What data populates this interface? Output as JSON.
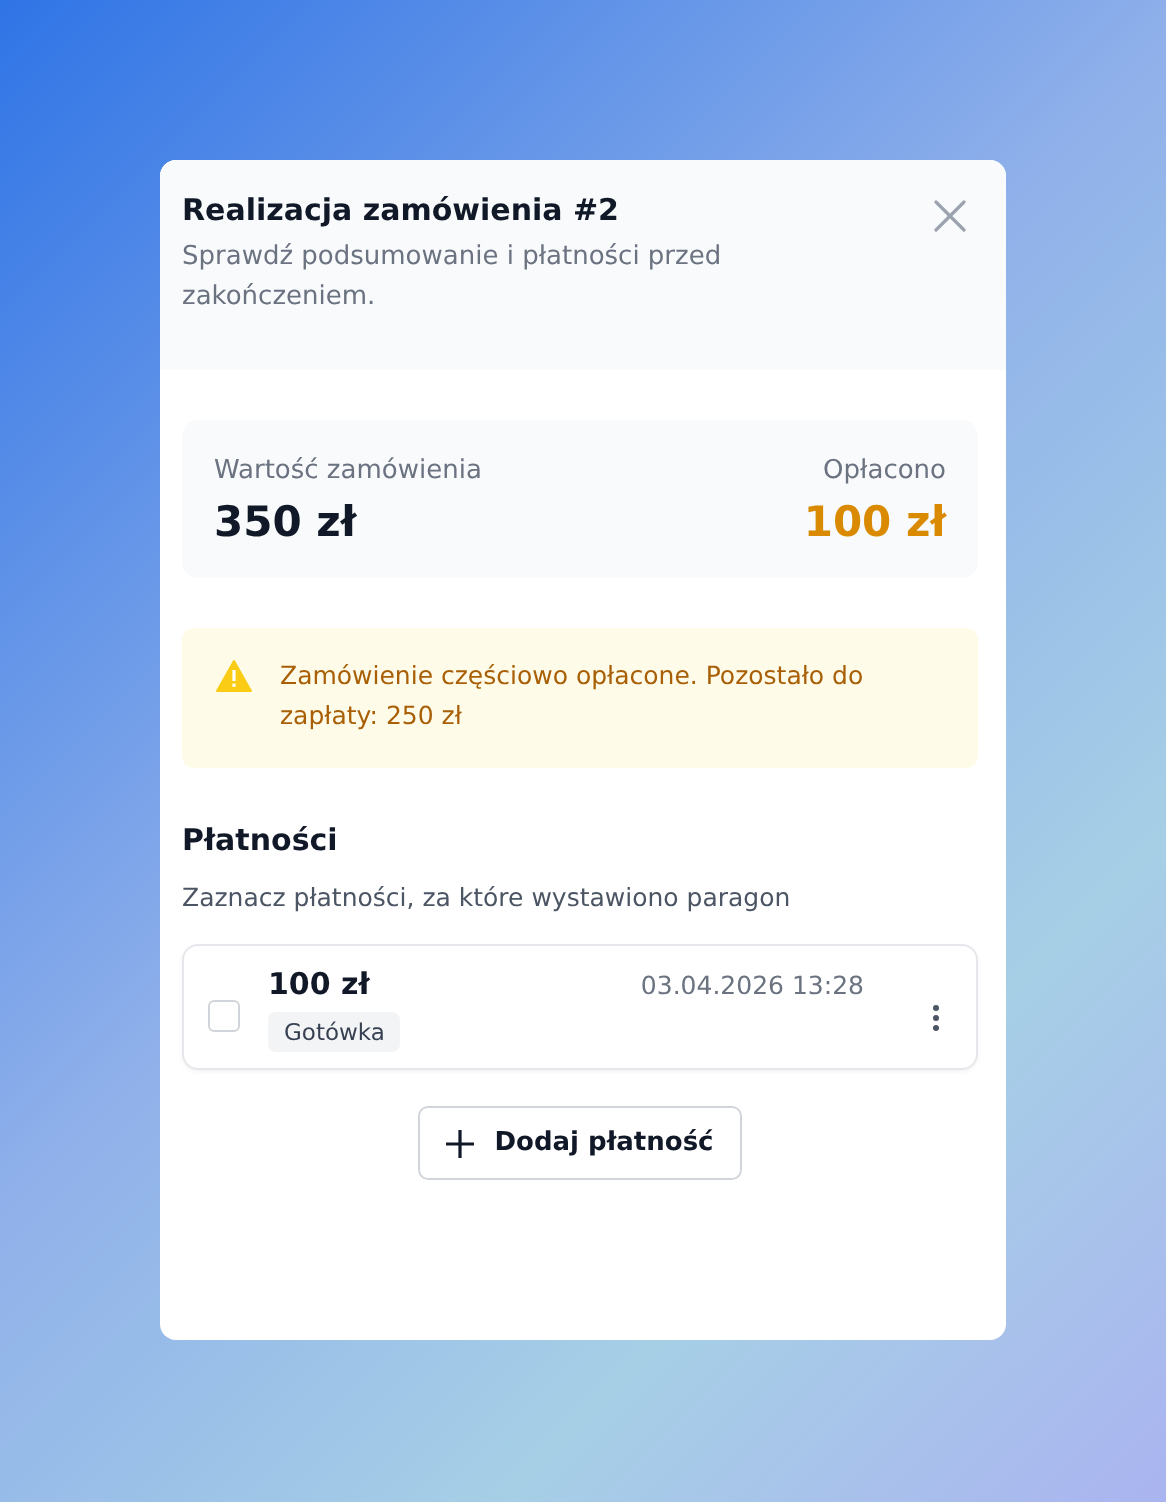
{
  "dialog": {
    "title": "Realizacja zamówienia #2",
    "subtitle": "Sprawdź podsumowanie i płatności przed zakończeniem."
  },
  "summary": {
    "order_label": "Wartość zamówienia",
    "order_value": "350 zł",
    "paid_label": "Opłacono",
    "paid_value": "100 zł"
  },
  "alert": {
    "kind": "warning",
    "text": "Zamówienie częściowo opłacone. Pozostało do zapłaty: 250 zł"
  },
  "payments": {
    "title": "Płatności",
    "hint": "Zaznacz płatności, za które wystawiono paragon",
    "items": [
      {
        "amount": "100 zł",
        "method": "Gotówka",
        "date": "03.04.2026 13:28",
        "checked": false
      }
    ],
    "add_button": "Dodaj płatność"
  }
}
